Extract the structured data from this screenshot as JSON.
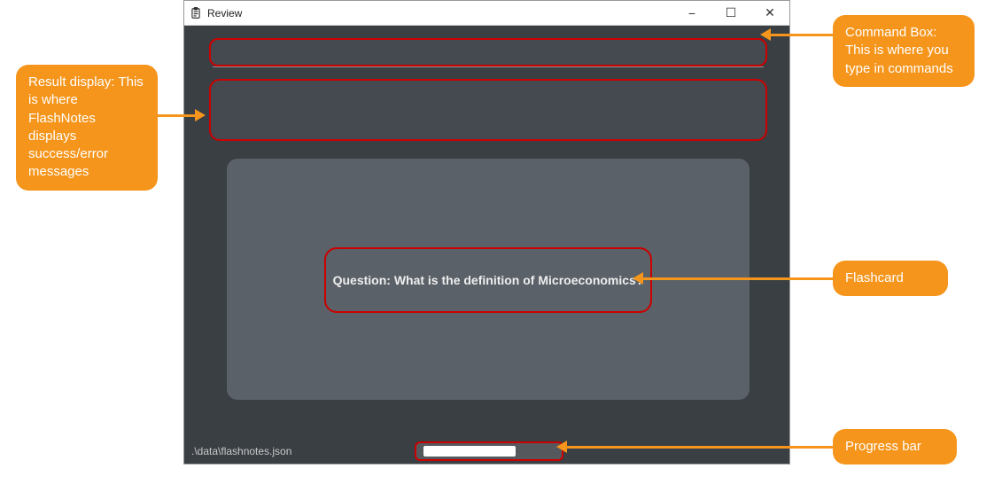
{
  "window": {
    "title": "Review",
    "statusPath": ".\\data\\flashnotes.json"
  },
  "commandBox": {
    "value": "",
    "placeholder": ""
  },
  "resultDisplay": {
    "message": ""
  },
  "flashcard": {
    "question": "Question: What is the definition of Microeconomics?"
  },
  "progress": {
    "percent": 70
  },
  "callouts": {
    "resultDisplay": "Result display: This is where FlashNotes displays success/error messages",
    "commandBox": "Command Box: This is where you type in commands",
    "flashcard": "Flashcard",
    "progressBar": "Progress bar"
  },
  "icons": {
    "app": "clipboard-list-icon",
    "minimize": "−",
    "maximize": "☐",
    "close": "✕"
  }
}
